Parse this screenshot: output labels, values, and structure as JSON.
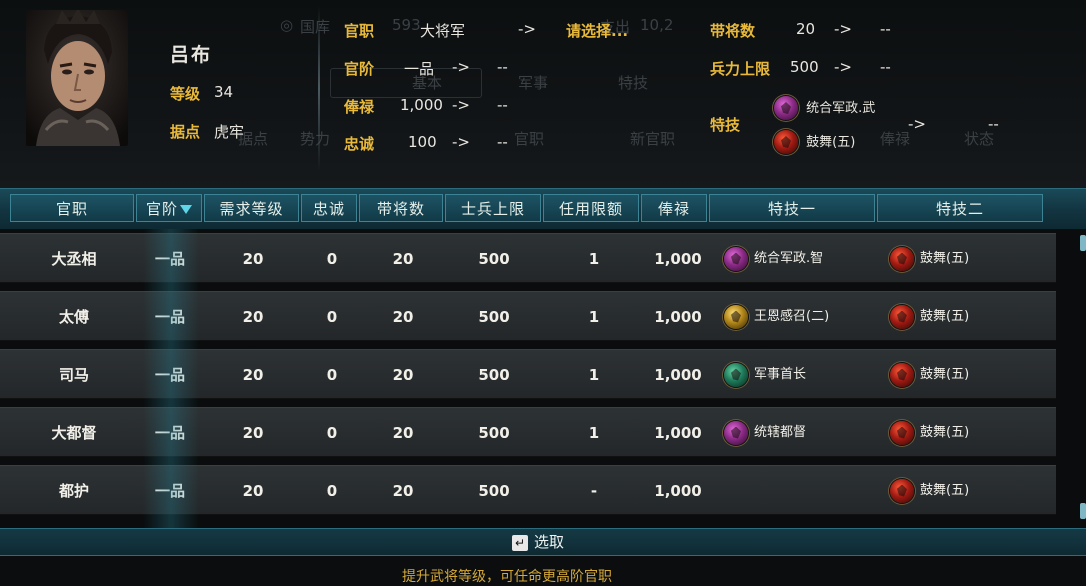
{
  "background_ghost": {
    "treasury_label": "国库",
    "treasury_value": "593",
    "expense_label": "支出",
    "expense_value": "10,2",
    "tab_basic": "基本",
    "tab_military": "军事",
    "tab_skill": "特技",
    "col_stronghold": "据点",
    "col_power": "势力",
    "col_rank": "官职",
    "col_new_rank": "新官职",
    "col_salary": "俸禄",
    "col_status": "状态"
  },
  "general": {
    "name": "吕布",
    "level_label": "等级",
    "level_value": "34",
    "base_label": "据点",
    "base_value": "虎牢"
  },
  "compare": {
    "post_label": "官职",
    "post_current": "大将军",
    "post_arrow": "->",
    "post_new": "请选择...",
    "grade_label": "官阶",
    "grade_current": "一品",
    "grade_arrow": "->",
    "grade_new": "--",
    "salary_label": "俸禄",
    "salary_current": "1,000",
    "salary_arrow": "->",
    "salary_new": "--",
    "loyalty_label": "忠诚",
    "loyalty_current": "100",
    "loyalty_arrow": "->",
    "loyalty_new": "--",
    "generals_label": "带将数",
    "generals_current": "20",
    "generals_arrow": "->",
    "generals_new": "--",
    "troops_label": "兵力上限",
    "troops_current": "500",
    "troops_arrow": "->",
    "troops_new": "--",
    "skill_label": "特技",
    "skill_1": "统合军政.武",
    "skill_2": "鼓舞(五)",
    "skill_arrow": "->",
    "skill_new": "--"
  },
  "table": {
    "headers": [
      "官职",
      "官阶",
      "需求等级",
      "忠诚",
      "带将数",
      "士兵上限",
      "任用限额",
      "俸禄",
      "特技一",
      "特技二"
    ],
    "rows": [
      {
        "post": "大丞相",
        "grade": "一品",
        "req_level": "20",
        "loyalty": "0",
        "generals": "20",
        "troops": "500",
        "quota": "1",
        "salary": "1,000",
        "skill1": "统合军政.智",
        "skill1_icon": "purple-skill-icon",
        "skill2": "鼓舞(五)",
        "skill2_icon": "red-drum-icon"
      },
      {
        "post": "太傅",
        "grade": "一品",
        "req_level": "20",
        "loyalty": "0",
        "generals": "20",
        "troops": "500",
        "quota": "1",
        "salary": "1,000",
        "skill1": "王恩感召(二)",
        "skill1_icon": "gold-skill-icon",
        "skill2": "鼓舞(五)",
        "skill2_icon": "red-drum-icon"
      },
      {
        "post": "司马",
        "grade": "一品",
        "req_level": "20",
        "loyalty": "0",
        "generals": "20",
        "troops": "500",
        "quota": "1",
        "salary": "1,000",
        "skill1": "军事首长",
        "skill1_icon": "green-skill-icon",
        "skill2": "鼓舞(五)",
        "skill2_icon": "red-drum-icon"
      },
      {
        "post": "大都督",
        "grade": "一品",
        "req_level": "20",
        "loyalty": "0",
        "generals": "20",
        "troops": "500",
        "quota": "1",
        "salary": "1,000",
        "skill1": "统辖都督",
        "skill1_icon": "purple-skill-icon",
        "skill2": "鼓舞(五)",
        "skill2_icon": "red-drum-icon"
      },
      {
        "post": "都护",
        "grade": "一品",
        "req_level": "20",
        "loyalty": "0",
        "generals": "20",
        "troops": "500",
        "quota": "-",
        "salary": "1,000",
        "skill1": "",
        "skill1_icon": "",
        "skill2": "鼓舞(五)",
        "skill2_icon": "red-drum-icon"
      }
    ]
  },
  "actions": {
    "select_key": "↵",
    "select_label": "选取"
  },
  "footer_hint": "提升武将等级，可任命更高阶官职",
  "colors": {
    "gold_label": "#e9b93a",
    "header_teal": "#123440",
    "row_bg": "#2d3234"
  }
}
